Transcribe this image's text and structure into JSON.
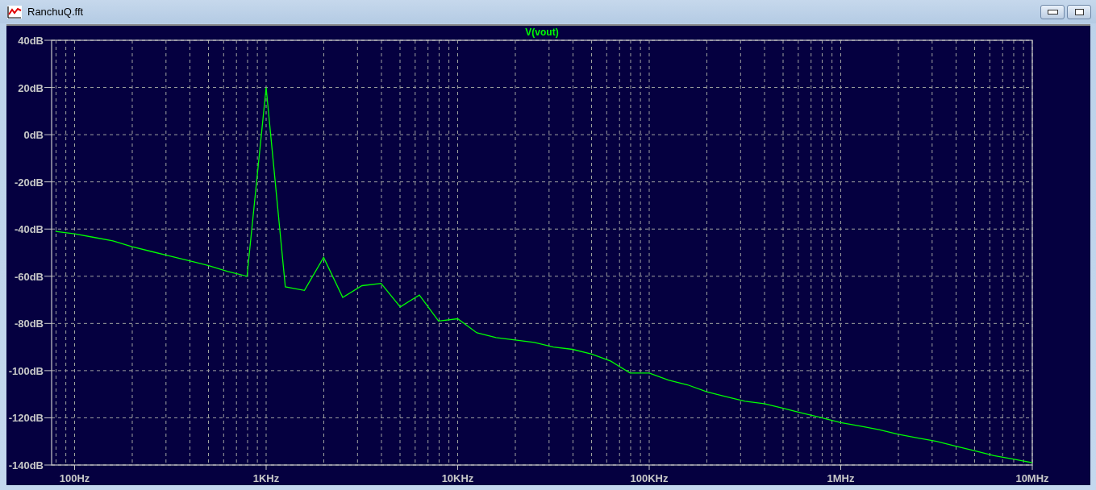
{
  "window": {
    "title": "RanchuQ.fft"
  },
  "chart_data": {
    "type": "line",
    "categories": [
      null,
      "100Hz",
      null,
      null,
      null,
      null,
      null,
      null,
      null,
      null,
      null,
      "1KHz",
      null,
      null,
      null,
      null,
      null,
      null,
      null,
      null,
      null,
      "10KHz",
      null,
      null,
      null,
      null,
      null,
      null,
      null,
      null,
      null,
      "100KHz",
      null,
      null,
      null,
      null,
      null,
      null,
      null,
      null,
      null,
      "1MHz",
      null,
      null,
      null,
      null,
      null,
      null,
      null,
      null,
      null,
      "10MHz"
    ],
    "series": [
      {
        "name": "V(vout)",
        "color": "#00ff00",
        "values": [
          -41,
          -42,
          -43.5,
          -45,
          -47.5,
          -49.5,
          -51.5,
          -53.5,
          -55.5,
          -58,
          -60,
          20,
          -64.5,
          -66,
          -52,
          -69,
          -64,
          -63,
          -73,
          -68,
          -79,
          -78,
          -84,
          -86,
          -87,
          -88,
          -90,
          -91,
          -93,
          -96,
          -101,
          -101,
          -104,
          -106,
          -109,
          -111,
          -113,
          -114,
          -116,
          -118,
          -120,
          -122,
          -123.5,
          -125,
          -127,
          -128.5,
          -130,
          -132,
          -134,
          -136,
          -137.5,
          -139
        ]
      }
    ],
    "grid": true,
    "ylim": [
      -140,
      40
    ],
    "yticks": [
      {
        "value": 40,
        "label": "40dB"
      },
      {
        "value": 20,
        "label": "20dB"
      },
      {
        "value": 0,
        "label": "0dB"
      },
      {
        "value": -20,
        "label": "-20dB"
      },
      {
        "value": -40,
        "label": "-40dB"
      },
      {
        "value": -60,
        "label": "-60dB"
      },
      {
        "value": -80,
        "label": "-80dB"
      },
      {
        "value": -100,
        "label": "-100dB"
      },
      {
        "value": -120,
        "label": "-120dB"
      },
      {
        "value": -140,
        "label": "-140dB"
      }
    ]
  }
}
